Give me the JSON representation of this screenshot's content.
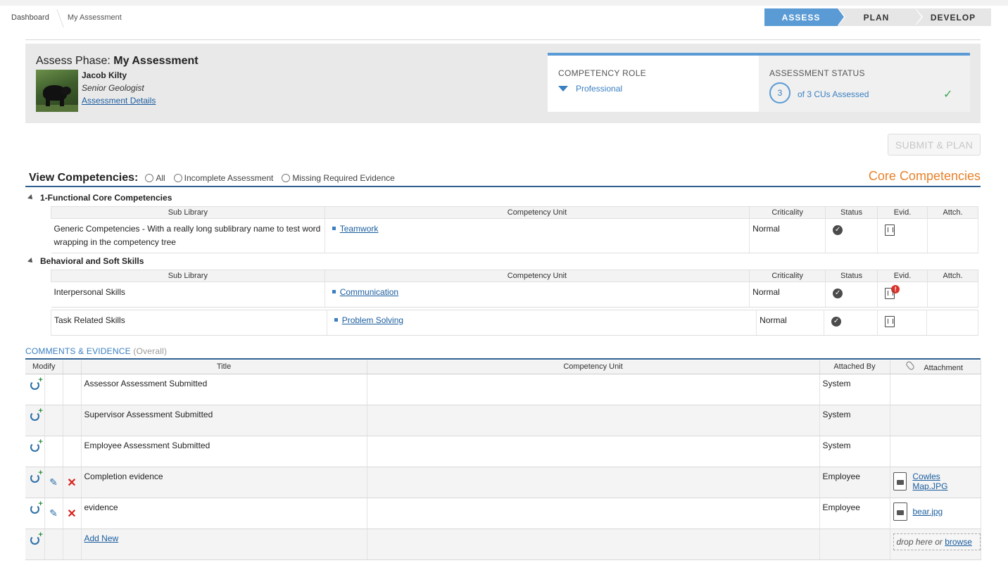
{
  "breadcrumb": {
    "items": [
      "Dashboard",
      "My Assessment"
    ]
  },
  "phases": {
    "assess": "ASSESS",
    "plan": "PLAN",
    "develop": "DEVELOP"
  },
  "header": {
    "phase_label": "Assess Phase:",
    "assessment_name": "My Assessment",
    "person_name": "Jacob Kilty",
    "person_role": "Senior Geologist",
    "details_link": "Assessment Details"
  },
  "competency_role": {
    "label": "COMPETENCY ROLE",
    "value": "Professional"
  },
  "assessment_status": {
    "label": "ASSESSMENT STATUS",
    "count": "3",
    "text": "of 3 CUs Assessed"
  },
  "submit_button": "SUBMIT & PLAN",
  "view": {
    "label": "View Competencies:",
    "options": [
      "All",
      "Incomplete Assessment",
      "Missing Required Evidence"
    ]
  },
  "core_title": "Core Competencies",
  "table_headers": {
    "sub_library": "Sub Library",
    "competency_unit": "Competency Unit",
    "criticality": "Criticality",
    "status": "Status",
    "evid": "Evid.",
    "attch": "Attch."
  },
  "groups": [
    {
      "title": "1-Functional Core Competencies",
      "rows": [
        {
          "sub_library": "Generic Competencies - With a really long sublibrary name to test word wrapping in the competency tree",
          "unit": "Teamwork",
          "criticality": "Normal"
        }
      ]
    },
    {
      "title": "Behavioral and Soft Skills",
      "rows": [
        {
          "sub_library": "Interpersonal Skills",
          "unit": "Communication",
          "criticality": "Normal"
        },
        {
          "sub_library": "Task Related Skills",
          "unit": "Problem Solving",
          "criticality": "Normal"
        }
      ]
    }
  ],
  "comments": {
    "title": "COMMENTS & EVIDENCE",
    "subtitle": "(Overall)",
    "headers": {
      "modify": "Modify",
      "title": "Title",
      "competency_unit": "Competency Unit",
      "attached_by": "Attached By",
      "attachment": "Attachment"
    },
    "rows": [
      {
        "title": "Assessor Assessment Submitted",
        "unit": "",
        "attached_by": "System",
        "attachment": ""
      },
      {
        "title": "Supervisor Assessment Submitted",
        "unit": "",
        "attached_by": "System",
        "attachment": ""
      },
      {
        "title": "Employee Assessment Submitted",
        "unit": "",
        "attached_by": "System",
        "attachment": ""
      },
      {
        "title": "Completion evidence",
        "unit": "",
        "attached_by": "Employee",
        "attachment": "Cowles Map.JPG"
      },
      {
        "title": "evidence",
        "unit": "",
        "attached_by": "Employee",
        "attachment": "bear.jpg"
      }
    ],
    "add_new": "Add New",
    "drop_text": "drop here or",
    "browse": "browse"
  }
}
